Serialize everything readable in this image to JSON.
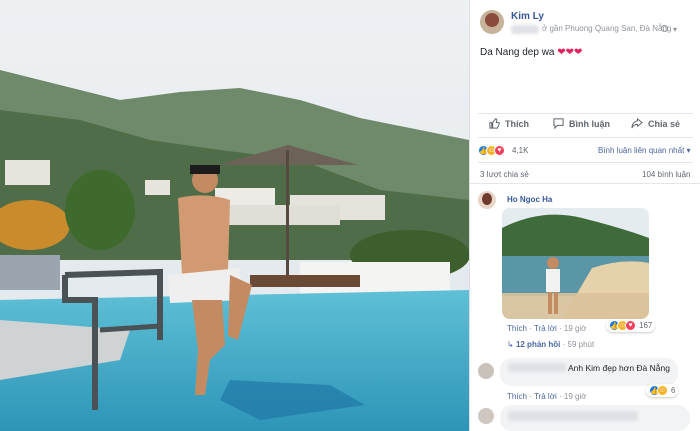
{
  "post": {
    "author": "Kim Ly",
    "location": "ở gần Phuong Quang San, Đà Nẵng",
    "text": "Da Nang dep wa",
    "hearts": "❤❤❤"
  },
  "actions": {
    "like": "Thích",
    "comment": "Bình luận",
    "share": "Chia sẻ"
  },
  "stats": {
    "reactions": "4,1K",
    "sort": "Bình luận liên quan nhất",
    "shares": "3 lượt chia sẻ",
    "comments": "104 bình luận"
  },
  "comments": [
    {
      "author": "Ho Ngoc Ha",
      "like": "Thích",
      "reply": "Trả lời",
      "time": "19 giờ",
      "reaction_count": "167",
      "replies_link": "12 phản hồi",
      "replies_time": "59 phút"
    },
    {
      "text": "Anh Kim đẹp hơn Đà Nẵng",
      "reaction_count": "6",
      "like": "Thích",
      "reply": "Trả lời",
      "time": "19 giờ"
    }
  ],
  "icons": {
    "like": "thumbs-up-icon",
    "comment": "speech-bubble-icon",
    "share": "share-arrow-icon",
    "sort": "caret-down-icon",
    "replies": "reply-arrow-icon"
  },
  "colors": {
    "link": "#365899",
    "like_blue": "#1877f2",
    "love_red": "#f33e58",
    "haha_yellow": "#f7b125"
  }
}
